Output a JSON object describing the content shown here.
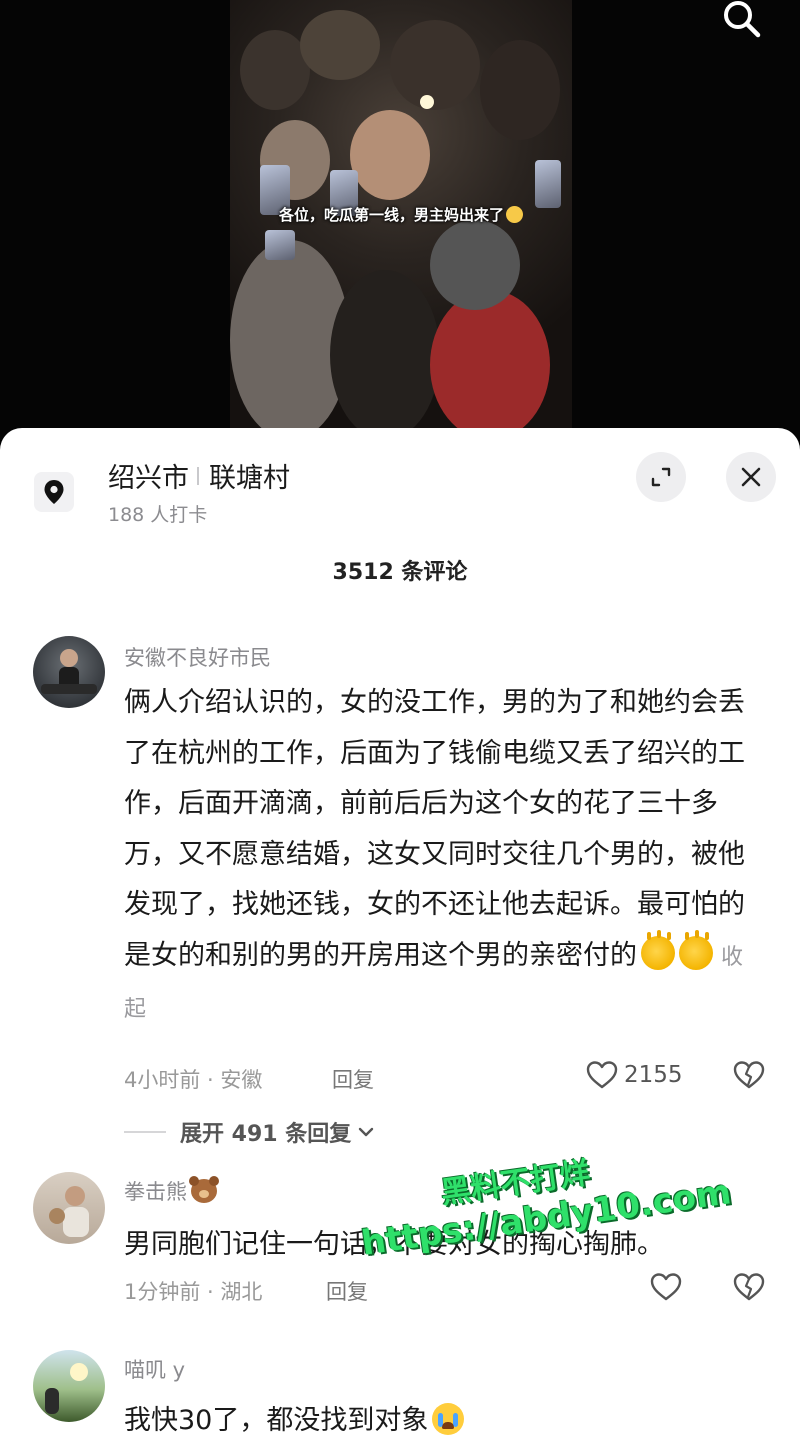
{
  "video": {
    "caption": "各位，吃瓜第一线，男主妈出来了"
  },
  "location": {
    "city": "绍兴市",
    "village": "联塘村",
    "checkins": "188 人打卡"
  },
  "comments_header": {
    "count_label": "3512 条评论"
  },
  "comments": [
    {
      "user": "安徽不良好市民",
      "text": "俩人介绍认识的，女的没工作，男的为了和她约会丢了在杭州的工作，后面为了钱偷电缆又丢了绍兴的工作，后面开滴滴，前前后后为这个女的花了三十多万，又不愿意结婚，这女又同时交往几个男的，被他发现了，找她还钱，女的不还让他去起诉。最可怕的是女的和别的男的开房用这个男的亲密付的",
      "collapse": "收起",
      "meta": "4小时前 · 安徽",
      "reply": "回复",
      "likes": "2155",
      "expand_replies": "展开 491 条回复"
    },
    {
      "user": "拳击熊",
      "text": "男同胞们记住一句话，不要对女的掏心掏肺。",
      "meta": "1分钟前 · 湖北",
      "reply": "回复"
    },
    {
      "user": "喵叽 y",
      "text": "我快30了，都没找到对象"
    }
  ],
  "watermark": {
    "line1": "黑料不打烊",
    "line2": "https://abdy10.com"
  },
  "icons": {
    "search": "search-icon",
    "location": "location-pin-icon",
    "expand": "expand-icon",
    "close": "close-icon",
    "like": "heart-icon",
    "dislike": "broken-heart-icon"
  }
}
